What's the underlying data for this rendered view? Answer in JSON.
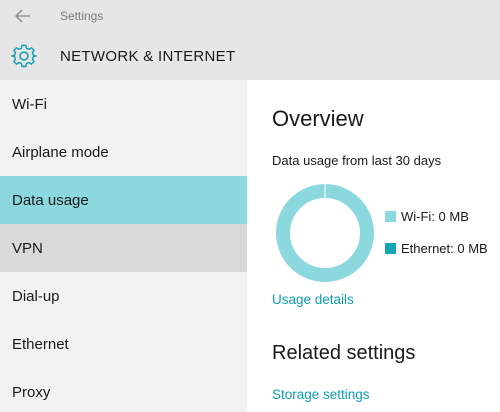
{
  "window": {
    "title": "Settings"
  },
  "header": {
    "title": "NETWORK & INTERNET"
  },
  "sidebar": {
    "items": [
      {
        "label": "Wi-Fi"
      },
      {
        "label": "Airplane mode"
      },
      {
        "label": "Data usage"
      },
      {
        "label": "VPN"
      },
      {
        "label": "Dial-up"
      },
      {
        "label": "Ethernet"
      },
      {
        "label": "Proxy"
      }
    ],
    "selected": "Data usage",
    "hovered": "VPN"
  },
  "main": {
    "overview_heading": "Overview",
    "data_usage_caption": "Data usage from last 30 days",
    "legend": [
      {
        "label": "Wi-Fi: 0 MB",
        "color": "#8bd8df"
      },
      {
        "label": "Ethernet: 0 MB",
        "color": "#14a5b4"
      }
    ],
    "usage_details_link": "Usage details",
    "related_heading": "Related settings",
    "storage_settings_link": "Storage settings"
  },
  "colors": {
    "accent": "#0f9fb0",
    "selected": "#8bd8df",
    "donut_ring": "#8bd8df"
  }
}
